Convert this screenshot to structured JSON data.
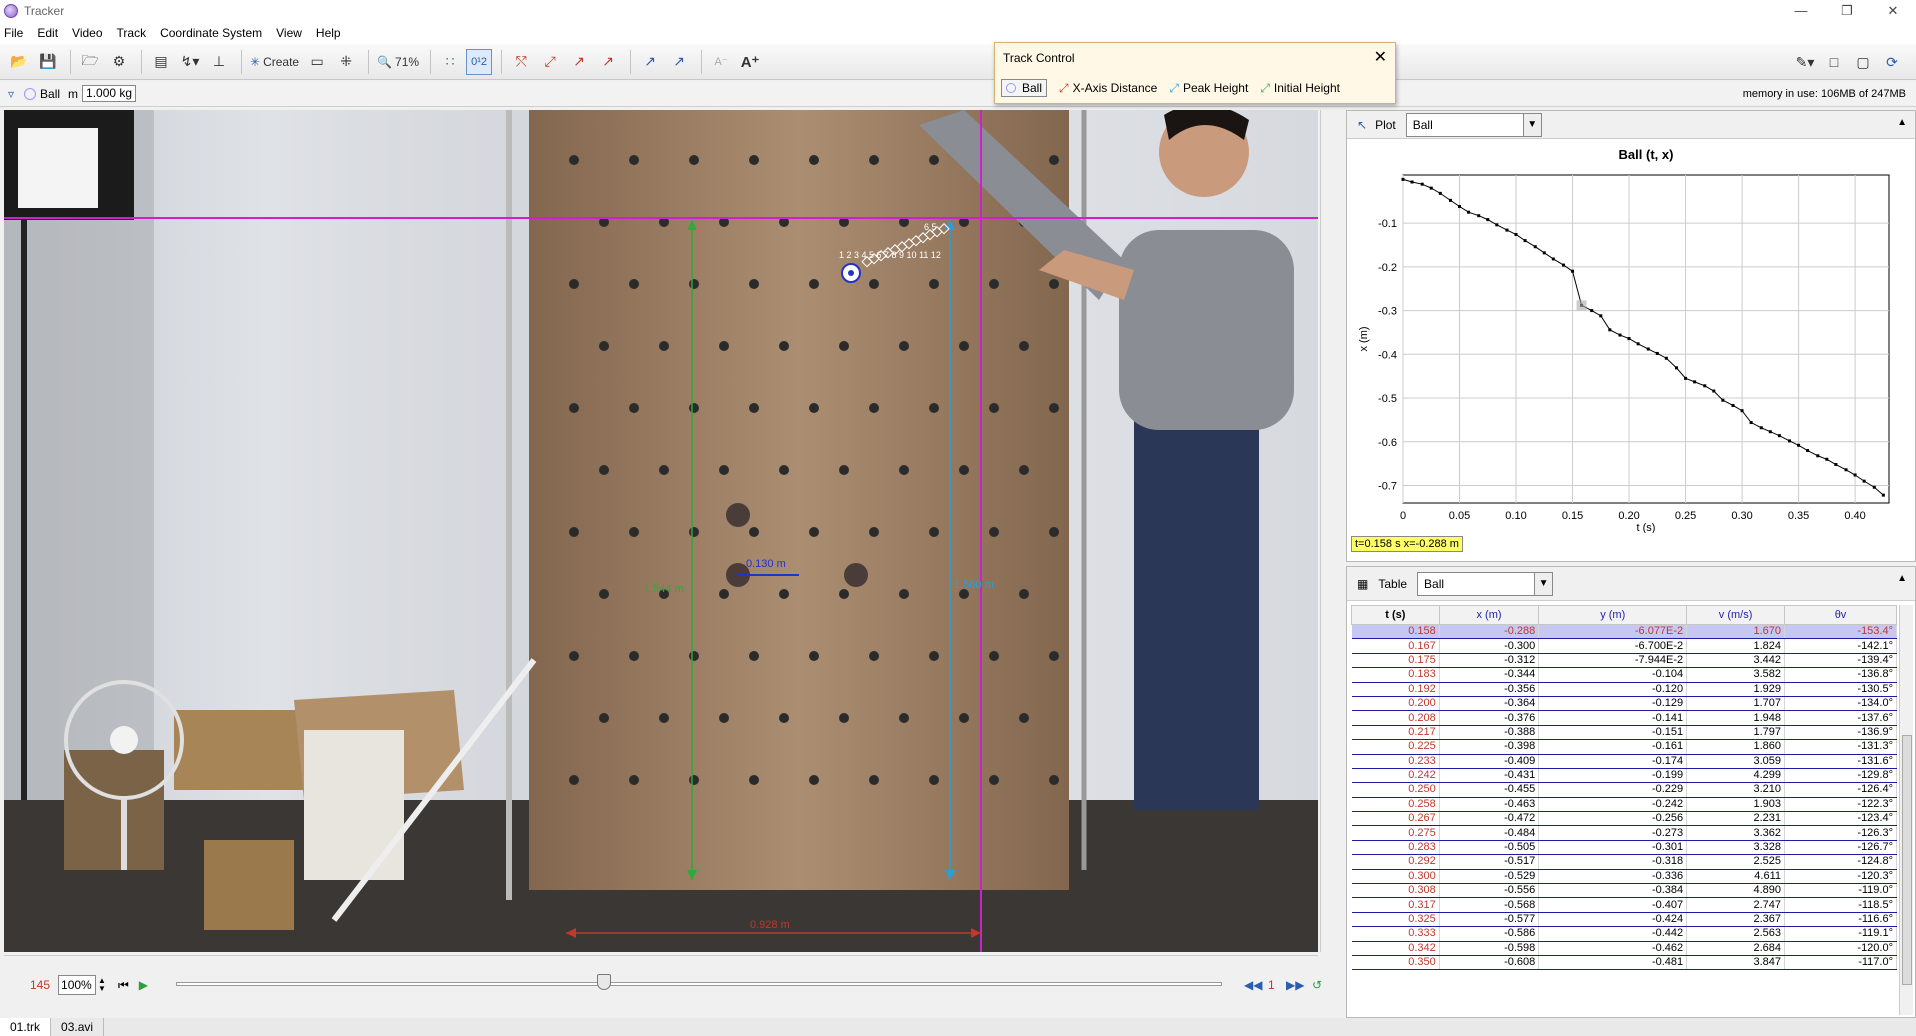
{
  "app": {
    "title": "Tracker"
  },
  "menu": [
    "File",
    "Edit",
    "Video",
    "Track",
    "Coordinate System",
    "View",
    "Help"
  ],
  "toolbar": {
    "create_label": "Create",
    "zoom_label": "71%"
  },
  "trackbar": {
    "track_name": "Ball",
    "mass_label": "m",
    "mass_value": "1.000 kg",
    "memory": "memory in use: 106MB of 247MB"
  },
  "track_control": {
    "title": "Track Control",
    "items": [
      {
        "label": "Ball",
        "color": "#9aa0ff"
      },
      {
        "label": "X-Axis Distance",
        "color": "#c0392b"
      },
      {
        "label": "Peak Height",
        "color": "#2a9fd6"
      },
      {
        "label": "Initial Height",
        "color": "#2eaa3c"
      }
    ]
  },
  "video": {
    "measure_green": "1.544 m",
    "measure_cyan": "1.560 m",
    "measure_red": "0.928 m",
    "calibration": "0.130 m",
    "point_labels": "1 2 3 4 5 6 7 8 9 10 11 12",
    "point_label_short": "6  5"
  },
  "player": {
    "frame": "145",
    "zoom": "100%",
    "step": "1"
  },
  "tabs": [
    "01.trk",
    "03.avi"
  ],
  "plot": {
    "label": "Plot",
    "track": "Ball",
    "readout": "t=0.158 s  x=-0.288 m",
    "chart_data": {
      "type": "line",
      "title": "Ball (t, x)",
      "xlabel": "t (s)",
      "ylabel": "x (m)",
      "xlim": [
        0,
        0.43
      ],
      "ylim": [
        -0.74,
        0.01
      ],
      "x_ticks": [
        "0",
        "0.05",
        "0.10",
        "0.15",
        "0.20",
        "0.25",
        "0.30",
        "0.35",
        "0.40"
      ],
      "y_ticks": [
        "-0.1",
        "-0.2",
        "-0.3",
        "-0.4",
        "-0.5",
        "-0.6",
        "-0.7"
      ],
      "x": [
        0.0,
        0.008,
        0.017,
        0.025,
        0.033,
        0.042,
        0.05,
        0.058,
        0.067,
        0.075,
        0.083,
        0.092,
        0.1,
        0.108,
        0.117,
        0.125,
        0.133,
        0.142,
        0.15,
        0.158,
        0.167,
        0.175,
        0.183,
        0.192,
        0.2,
        0.208,
        0.217,
        0.225,
        0.233,
        0.242,
        0.25,
        0.258,
        0.267,
        0.275,
        0.283,
        0.292,
        0.3,
        0.308,
        0.317,
        0.325,
        0.333,
        0.342,
        0.35,
        0.358,
        0.367,
        0.375,
        0.383,
        0.392,
        0.4,
        0.408,
        0.417,
        0.425
      ],
      "y": [
        0.0,
        -0.006,
        -0.011,
        -0.02,
        -0.032,
        -0.048,
        -0.062,
        -0.075,
        -0.083,
        -0.092,
        -0.104,
        -0.116,
        -0.126,
        -0.14,
        -0.154,
        -0.168,
        -0.182,
        -0.196,
        -0.21,
        -0.288,
        -0.3,
        -0.312,
        -0.344,
        -0.356,
        -0.364,
        -0.376,
        -0.388,
        -0.398,
        -0.409,
        -0.431,
        -0.455,
        -0.463,
        -0.472,
        -0.484,
        -0.505,
        -0.517,
        -0.529,
        -0.556,
        -0.568,
        -0.577,
        -0.586,
        -0.598,
        -0.608,
        -0.62,
        -0.632,
        -0.64,
        -0.652,
        -0.664,
        -0.676,
        -0.69,
        -0.704,
        -0.722
      ]
    }
  },
  "table": {
    "label": "Table",
    "track": "Ball",
    "columns": [
      "t (s)",
      "x (m)",
      "y (m)",
      "v (m/s)",
      "θv"
    ],
    "rows": [
      [
        "0.158",
        "-0.288",
        "-6.077E-2",
        "1.670",
        "-153.4°"
      ],
      [
        "0.167",
        "-0.300",
        "-6.700E-2",
        "1.824",
        "-142.1°"
      ],
      [
        "0.175",
        "-0.312",
        "-7.944E-2",
        "3.442",
        "-139.4°"
      ],
      [
        "0.183",
        "-0.344",
        "-0.104",
        "3.582",
        "-136.8°"
      ],
      [
        "0.192",
        "-0.356",
        "-0.120",
        "1.929",
        "-130.5°"
      ],
      [
        "0.200",
        "-0.364",
        "-0.129",
        "1.707",
        "-134.0°"
      ],
      [
        "0.208",
        "-0.376",
        "-0.141",
        "1.948",
        "-137.6°"
      ],
      [
        "0.217",
        "-0.388",
        "-0.151",
        "1.797",
        "-136.9°"
      ],
      [
        "0.225",
        "-0.398",
        "-0.161",
        "1.860",
        "-131.3°"
      ],
      [
        "0.233",
        "-0.409",
        "-0.174",
        "3.059",
        "-131.6°"
      ],
      [
        "0.242",
        "-0.431",
        "-0.199",
        "4.299",
        "-129.8°"
      ],
      [
        "0.250",
        "-0.455",
        "-0.229",
        "3.210",
        "-126.4°"
      ],
      [
        "0.258",
        "-0.463",
        "-0.242",
        "1.903",
        "-122.3°"
      ],
      [
        "0.267",
        "-0.472",
        "-0.256",
        "2.231",
        "-123.4°"
      ],
      [
        "0.275",
        "-0.484",
        "-0.273",
        "3.362",
        "-126.3°"
      ],
      [
        "0.283",
        "-0.505",
        "-0.301",
        "3.328",
        "-126.7°"
      ],
      [
        "0.292",
        "-0.517",
        "-0.318",
        "2.525",
        "-124.8°"
      ],
      [
        "0.300",
        "-0.529",
        "-0.336",
        "4.611",
        "-120.3°"
      ],
      [
        "0.308",
        "-0.556",
        "-0.384",
        "4.890",
        "-119.0°"
      ],
      [
        "0.317",
        "-0.568",
        "-0.407",
        "2.747",
        "-118.5°"
      ],
      [
        "0.325",
        "-0.577",
        "-0.424",
        "2.367",
        "-116.6°"
      ],
      [
        "0.333",
        "-0.586",
        "-0.442",
        "2.563",
        "-119.1°"
      ],
      [
        "0.342",
        "-0.598",
        "-0.462",
        "2.684",
        "-120.0°"
      ],
      [
        "0.350",
        "-0.608",
        "-0.481",
        "3.847",
        "-117.0°"
      ]
    ]
  }
}
